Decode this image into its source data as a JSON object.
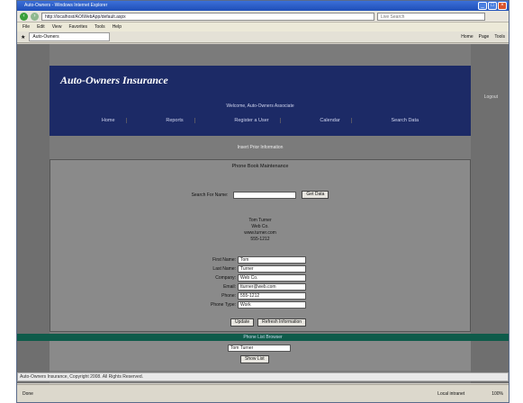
{
  "window": {
    "title": "Auto-Owners - Windows Internet Explorer"
  },
  "browser": {
    "address": "http://localhost/AOIWebApp/default.aspx",
    "search_placeholder": "Live Search",
    "menus": [
      "File",
      "Edit",
      "View",
      "Favorites",
      "Tools",
      "Help"
    ],
    "tab_label": "Auto-Owners",
    "tools": [
      "Home",
      "Page",
      "Tools"
    ]
  },
  "site": {
    "logo": "Auto-Owners Insurance",
    "logout": "Logout",
    "welcome": "Welcome, Auto-Owners Associate",
    "nav": [
      "Home",
      "Reports",
      "Register a User",
      "Calendar",
      "Search Data"
    ],
    "subtitle": "Insert Prior Information"
  },
  "panel": {
    "title": "Phone Book Maintenance",
    "search_label": "Search For Name:",
    "search_value": "",
    "search_button": "Get Data",
    "contact": [
      "Tom Turner",
      "Web Co.",
      "www.turner.com",
      "555-1212"
    ]
  },
  "form": {
    "fields": [
      {
        "label": "First Name:",
        "value": "Tom"
      },
      {
        "label": "Last Name:",
        "value": "Turner"
      },
      {
        "label": "Company:",
        "value": "Web Co."
      },
      {
        "label": "Email:",
        "value": "tturner@web.com"
      },
      {
        "label": "Phone:",
        "value": "555-1212"
      },
      {
        "label": "Phone Type:",
        "value": "Work"
      }
    ],
    "update_button": "Update",
    "refresh_button": "Refresh Information"
  },
  "lower": {
    "bar_text": "Phone List Browser",
    "select_value": "Tom Turner",
    "button": "Show List"
  },
  "footer": {
    "text": "Auto-Owners Insurance, Copyright 2008. All Rights Reserved."
  },
  "status": {
    "left": "Done",
    "zone": "Local intranet",
    "zoom": "100%"
  }
}
